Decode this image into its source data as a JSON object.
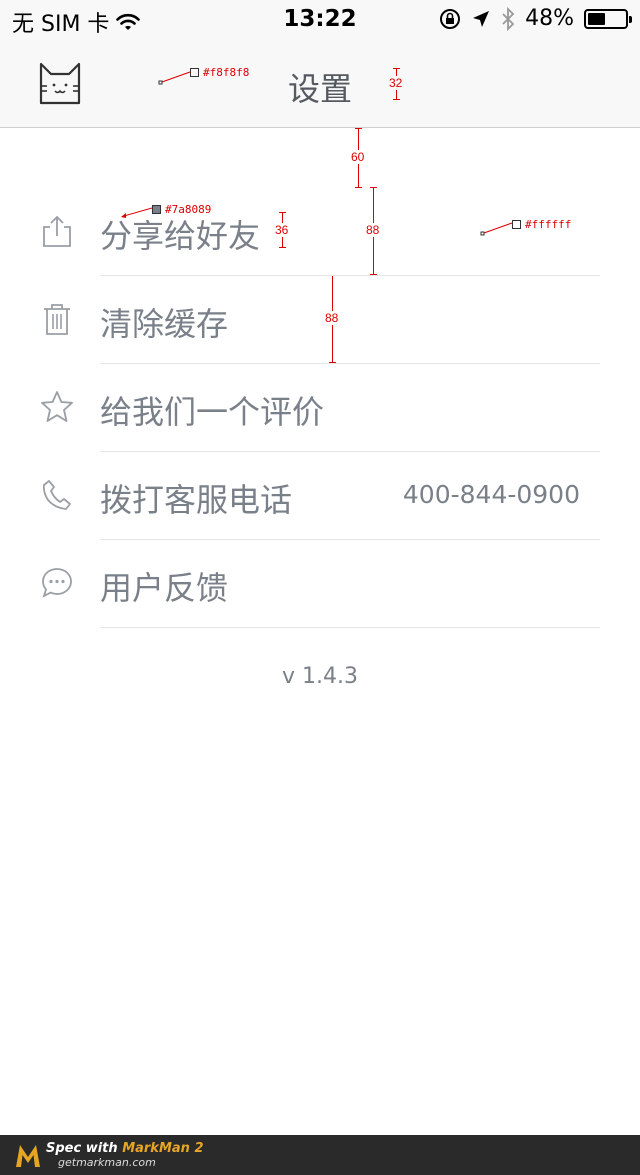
{
  "status_bar": {
    "carrier": "无 SIM 卡",
    "time": "13:22",
    "battery": "48%",
    "battery_level": 0.48
  },
  "nav": {
    "title": "设置",
    "logo_icon": "cat-face-icon"
  },
  "spec": {
    "navbar_color": "#f8f8f8",
    "text_color": "#7a8089",
    "background_color": "#ffffff",
    "dim_title": "32",
    "dim_top_gap": "60",
    "dim_row_height": "88",
    "dim_font": "36",
    "dim_row2_height": "88"
  },
  "settings": {
    "items": [
      {
        "label": "分享给好友",
        "icon": "share-icon",
        "value": ""
      },
      {
        "label": "清除缓存",
        "icon": "trash-icon",
        "value": ""
      },
      {
        "label": "给我们一个评价",
        "icon": "star-icon",
        "value": ""
      },
      {
        "label": "拨打客服电话",
        "icon": "phone-icon",
        "value": "400-844-0900"
      },
      {
        "label": "用户反馈",
        "icon": "chat-bubble-icon",
        "value": ""
      }
    ]
  },
  "version": "v 1.4.3",
  "banner": {
    "spec_prefix": "Spec with ",
    "spec_brand": "MarkMan 2",
    "url": "getmarkman.com"
  }
}
